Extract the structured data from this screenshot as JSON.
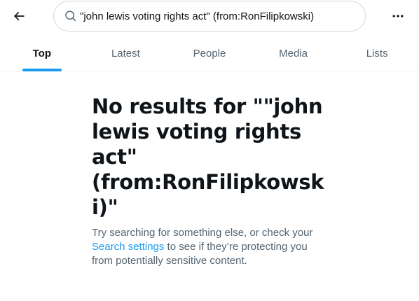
{
  "header": {
    "back_icon": "arrow-left-icon",
    "search": {
      "icon": "search-icon",
      "value": "\"john lewis voting rights act\" (from:RonFilipkowski)"
    },
    "more_icon": "more-horizontal-icon"
  },
  "tabs": [
    {
      "label": "Top",
      "active": true
    },
    {
      "label": "Latest",
      "active": false
    },
    {
      "label": "People",
      "active": false
    },
    {
      "label": "Media",
      "active": false
    },
    {
      "label": "Lists",
      "active": false
    }
  ],
  "empty_state": {
    "title": "No results for \"\"john lewis voting rights act\" (from:RonFilipkowski)\"",
    "body_before": "Try searching for something else, or check your ",
    "link": "Search settings",
    "body_after": " to see if they’re protecting you from potentially sensitive content."
  },
  "colors": {
    "accent": "#1d9bf0",
    "text_primary": "#0f1419",
    "text_secondary": "#536471",
    "border": "#cfd9de"
  }
}
